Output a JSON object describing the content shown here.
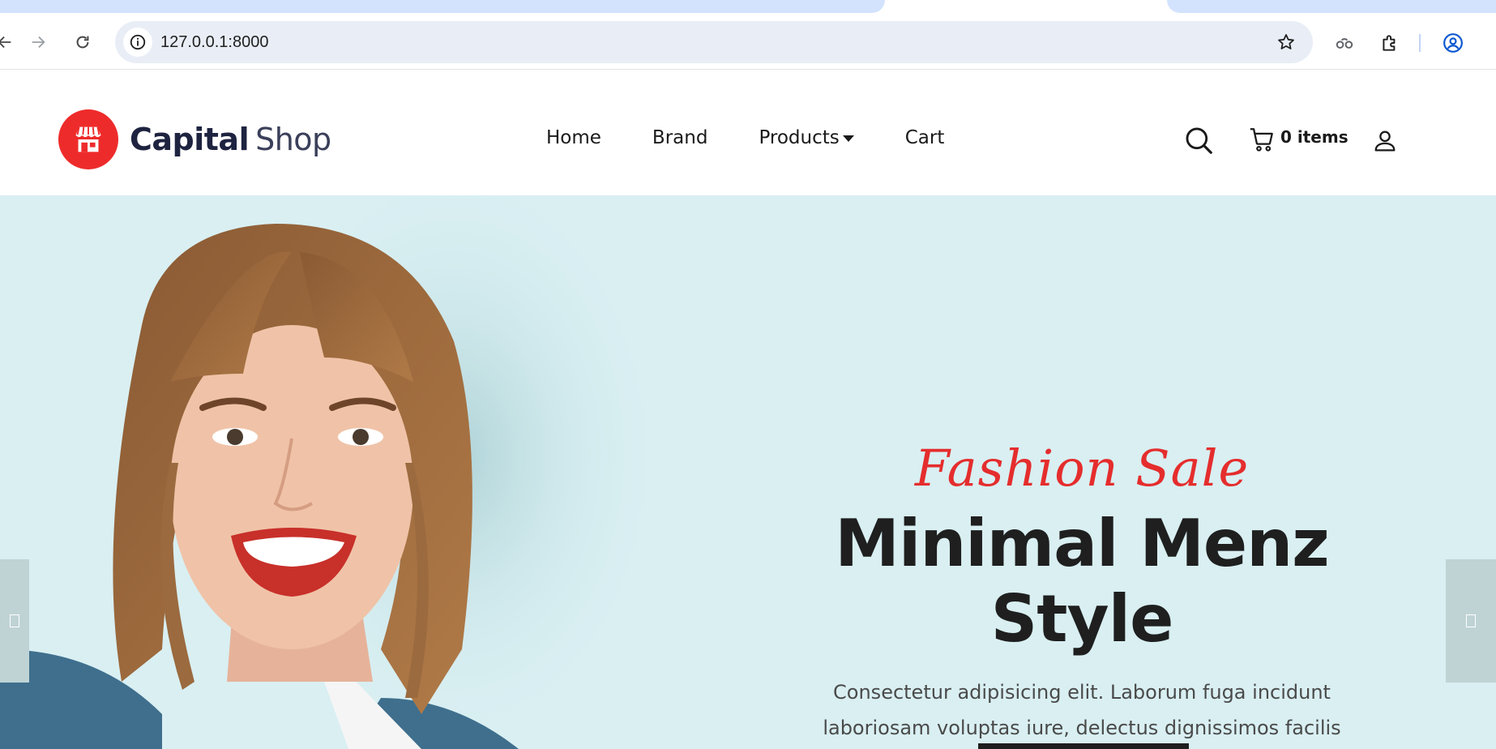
{
  "browser": {
    "url": "127.0.0.1:8000"
  },
  "site": {
    "brand_bold": "Capital",
    "brand_light": "Shop",
    "brand_color": "#ee2b2b",
    "nav": [
      {
        "label": "Home"
      },
      {
        "label": "Brand"
      },
      {
        "label": "Products"
      },
      {
        "label": "Cart"
      }
    ],
    "cart_label": "0 items"
  },
  "hero": {
    "script_title": "Fashion Sale",
    "title": "Minimal Menz Style",
    "description": "Consectetur adipisicing elit. Laborum fuga incidunt laboriosam voluptas iure, delectus dignissimos facilis neque nulla earum.",
    "accent_color": "#e52d2d",
    "background_color": "#d9eff2"
  }
}
